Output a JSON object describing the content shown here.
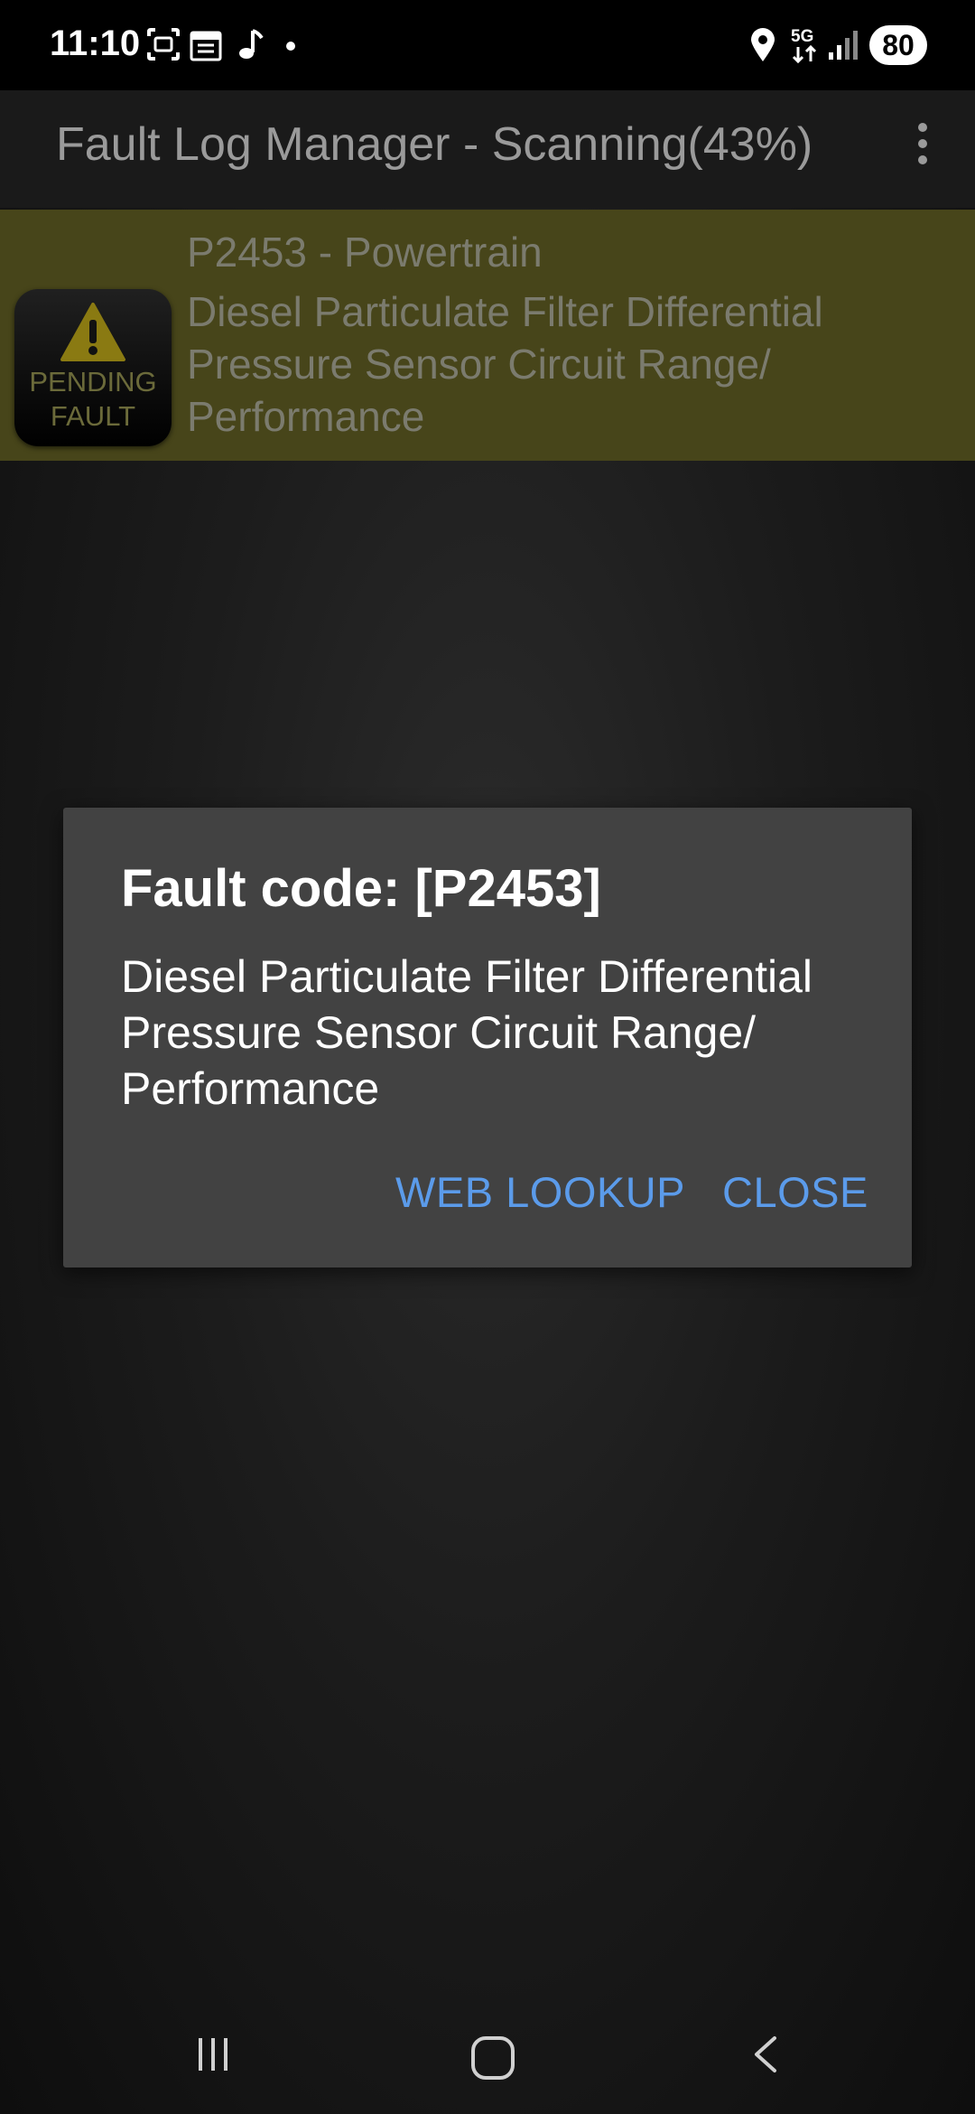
{
  "status_bar": {
    "time": "11:10",
    "battery": "80",
    "left_icons": [
      "screenshot-icon",
      "calendar-icon",
      "music-note-icon",
      "dot-icon"
    ],
    "right_icons": [
      "location-icon",
      "5g-icon",
      "signal-icon"
    ]
  },
  "app_bar": {
    "title": "Fault Log Manager - Scanning(43%)",
    "menu_icon": "overflow-menu-icon"
  },
  "fault_list": [
    {
      "badge_line1": "PENDING",
      "badge_line2": "FAULT",
      "code_line": "P2453 - Powertrain",
      "description": "Diesel Particulate Filter Differential Pressure Sensor Circuit Range/ Performance"
    }
  ],
  "dialog": {
    "title": "Fault code: [P2453]",
    "message": "Diesel Particulate Filter Differential Pressure Sensor Circuit Range/ Performance",
    "web_lookup_label": "WEB LOOKUP",
    "close_label": "CLOSE"
  },
  "colors": {
    "accent": "#5b9bea",
    "dialog_bg": "#424242",
    "fault_row_bg": "#47451a",
    "warning_yellow": "#e0c21c"
  },
  "nav_bar": [
    "recents-icon",
    "home-icon",
    "back-icon"
  ]
}
